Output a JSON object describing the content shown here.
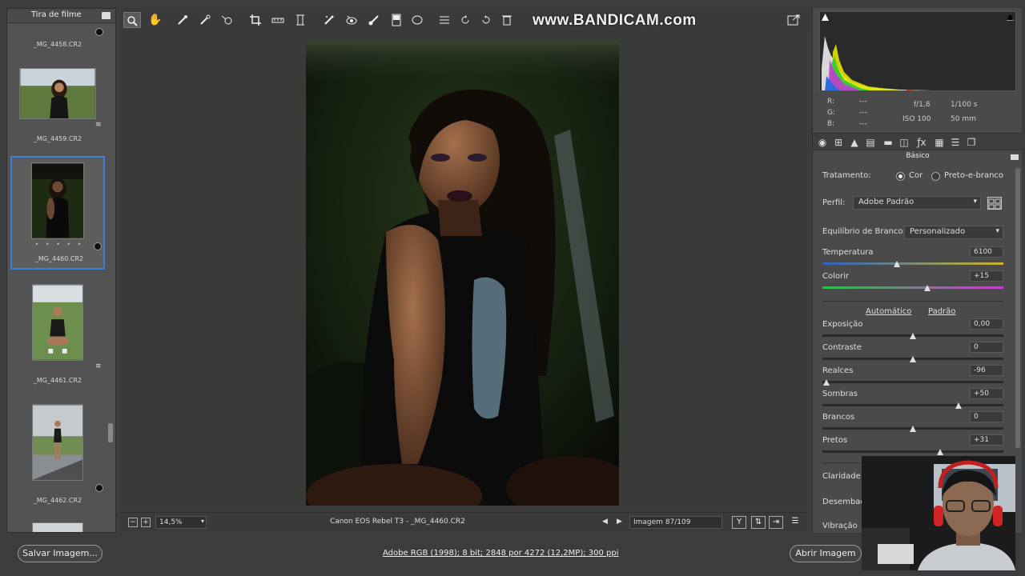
{
  "watermark": "www.BANDICAM.com",
  "filmstrip": {
    "title": "Tira de filme",
    "items": [
      {
        "label": "_MG_4458.CR2"
      },
      {
        "label": "_MG_4459.CR2"
      },
      {
        "label": "_MG_4460.CR2",
        "selected": true
      },
      {
        "label": "_MG_4461.CR2"
      },
      {
        "label": "_MG_4462.CR2"
      }
    ]
  },
  "toolbar": {
    "tools": [
      "zoom-icon",
      "hand-icon",
      "white-balance-icon",
      "color-sampler-icon",
      "target-adjust-icon",
      "crop-icon",
      "straighten-icon",
      "transform-icon",
      "spot-removal-icon",
      "red-eye-icon",
      "adjustment-brush-icon",
      "graduated-filter-icon",
      "radial-filter-icon",
      "preferences-icon",
      "rotate-left-icon",
      "rotate-right-icon"
    ],
    "export_icon": "export-icon"
  },
  "preview_bar": {
    "zoom": "14,5%",
    "camera_info": "Canon EOS Rebel T3  -  _MG_4460.CR2",
    "image_counter": "Imagem 87/109"
  },
  "bottom": {
    "save_label": "Salvar Imagem...",
    "workflow_info": "Adobe RGB (1998); 8 bit; 2848 por 4272 (12,2MP); 300 ppi",
    "open_label": "Abrir Imagem"
  },
  "readout": {
    "r_label": "R:",
    "g_label": "G:",
    "b_label": "B:",
    "r_val": "---",
    "g_val": "---",
    "b_val": "---",
    "aperture": "f/1,8",
    "shutter": "1/100 s",
    "iso": "ISO 100",
    "focal": "50 mm"
  },
  "panel": {
    "title": "Básico",
    "treatment_label": "Tratamento:",
    "treatment_color": "Cor",
    "treatment_bw": "Preto-e-branco",
    "profile_label": "Perfil:",
    "profile_value": "Adobe Padrão",
    "wb_label": "Equilíbrio de Branco:",
    "wb_value": "Personalizado",
    "auto_label": "Automático",
    "default_label": "Padrão",
    "sliders": [
      {
        "label": "Temperatura",
        "value": "6100",
        "pos": 0.41
      },
      {
        "label": "Colorir",
        "value": "+15",
        "pos": 0.58
      },
      {
        "label": "Exposição",
        "value": "0,00",
        "pos": 0.5
      },
      {
        "label": "Contraste",
        "value": "0",
        "pos": 0.5
      },
      {
        "label": "Realces",
        "value": "-96",
        "pos": 0.02
      },
      {
        "label": "Sombras",
        "value": "+50",
        "pos": 0.75
      },
      {
        "label": "Brancos",
        "value": "0",
        "pos": 0.5
      },
      {
        "label": "Pretos",
        "value": "+31",
        "pos": 0.65
      }
    ],
    "more_labels": [
      "Claridade",
      "Desembaçar",
      "Vibração"
    ]
  }
}
